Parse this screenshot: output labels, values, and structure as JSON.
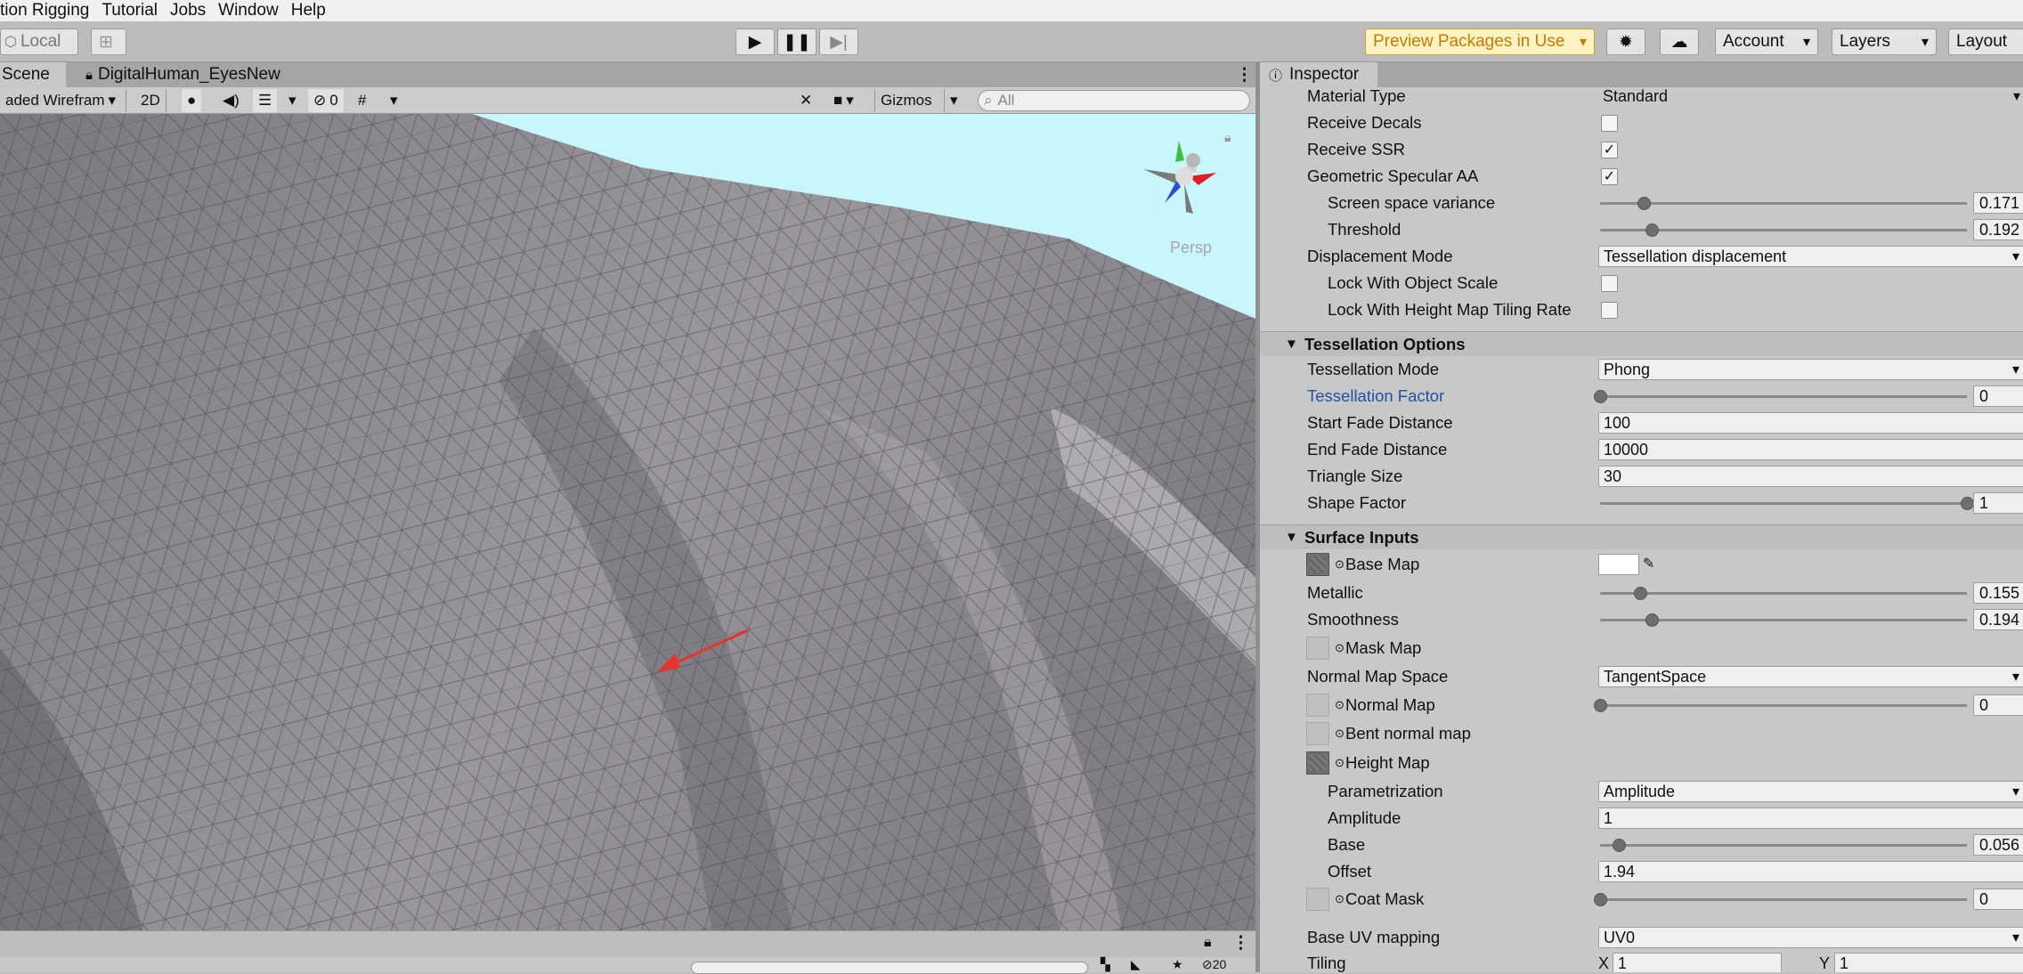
{
  "menu": [
    "tion Rigging",
    "Tutorial",
    "Jobs",
    "Window",
    "Help"
  ],
  "toolbar": {
    "local_label": "Local",
    "preview_packages": "Preview Packages in Use",
    "account": "Account",
    "layers": "Layers",
    "layout": "Layout"
  },
  "scene": {
    "tab_scene": "Scene",
    "tab_file": "DigitalHuman_EyesNew",
    "shading_mode": "aded Wirefram",
    "btn_2d": "2D",
    "hidden_count": "0",
    "gizmos": "Gizmos",
    "search_placeholder": "All",
    "persp": "Persp",
    "bottom_count": "20"
  },
  "inspector": {
    "tab": "Inspector",
    "rows": {
      "material_type": {
        "label": "Material Type",
        "value": "Standard"
      },
      "receive_decals": {
        "label": "Receive Decals",
        "checked": false
      },
      "receive_ssr": {
        "label": "Receive SSR",
        "checked": true,
        "mark": "✓"
      },
      "geometric_aa": {
        "label": "Geometric Specular AA",
        "checked": true,
        "mark": "✓"
      },
      "screen_space_variance": {
        "label": "Screen space variance",
        "value": "0.171",
        "fraction": 0.12
      },
      "threshold": {
        "label": "Threshold",
        "value": "0.192",
        "fraction": 0.14
      },
      "displacement_mode": {
        "label": "Displacement Mode",
        "value": "Tessellation displacement"
      },
      "lock_object_scale": {
        "label": "Lock With Object Scale",
        "checked": false
      },
      "lock_height_map": {
        "label": "Lock With Height Map Tiling Rate",
        "checked": false
      },
      "tess_section": {
        "label": "Tessellation Options"
      },
      "tess_mode": {
        "label": "Tessellation Mode",
        "value": "Phong"
      },
      "tess_factor": {
        "label": "Tessellation Factor",
        "value": "0",
        "fraction": 0.0
      },
      "start_fade": {
        "label": "Start Fade Distance",
        "value": "100"
      },
      "end_fade": {
        "label": "End Fade Distance",
        "value": "10000"
      },
      "triangle_size": {
        "label": "Triangle Size",
        "value": "30"
      },
      "shape_factor": {
        "label": "Shape Factor",
        "value": "1",
        "fraction": 1.0
      },
      "surface_section": {
        "label": "Surface Inputs"
      },
      "base_map": {
        "label": "Base Map"
      },
      "metallic": {
        "label": "Metallic",
        "value": "0.155",
        "fraction": 0.11
      },
      "smoothness": {
        "label": "Smoothness",
        "value": "0.194",
        "fraction": 0.14
      },
      "mask_map": {
        "label": "Mask Map"
      },
      "normal_map_space": {
        "label": "Normal Map Space",
        "value": "TangentSpace"
      },
      "normal_map": {
        "label": "Normal Map",
        "value": "0",
        "fraction": 0.0
      },
      "bent_normal": {
        "label": "Bent normal map"
      },
      "height_map": {
        "label": "Height Map"
      },
      "parametrization": {
        "label": "Parametrization",
        "value": "Amplitude"
      },
      "amplitude": {
        "label": "Amplitude",
        "value": "1"
      },
      "base": {
        "label": "Base",
        "value": "0.056",
        "fraction": 0.05
      },
      "offset": {
        "label": "Offset",
        "value": "1.94"
      },
      "coat_mask": {
        "label": "Coat Mask",
        "value": "0",
        "fraction": 0.0
      },
      "base_uv": {
        "label": "Base UV mapping",
        "value": "UV0"
      },
      "tiling": {
        "label": "Tiling",
        "x_label": "X",
        "x": "1",
        "y_label": "Y",
        "y": "1"
      }
    }
  },
  "colors": {
    "sky": "#c7f7fc",
    "mesh": "#8d8a90",
    "arrow": "#e8322e",
    "accent_link": "#2351a8",
    "preview_badge": "#fff3c4"
  }
}
